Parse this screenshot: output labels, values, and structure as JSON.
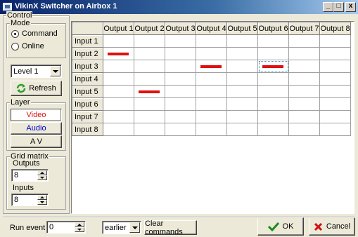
{
  "window": {
    "title": "VikinX Switcher on Airbox 1"
  },
  "title_buttons": {
    "minimize": "_",
    "maximize": "□",
    "close": "x"
  },
  "control": {
    "legend": "Control",
    "mode": {
      "legend": "Mode",
      "options": [
        "Command",
        "Online"
      ],
      "selected": "Command"
    },
    "level": {
      "value": "Level 1"
    },
    "refresh_label": "Refresh",
    "layer": {
      "legend": "Layer",
      "video_label": "Video",
      "audio_label": "Audio",
      "av_label": "A V",
      "video_color": "#e01010",
      "audio_color": "#0000d0"
    },
    "grid_matrix": {
      "legend": "Grid matrix",
      "outputs_label": "Outputs",
      "outputs_value": "8",
      "inputs_label": "Inputs",
      "inputs_value": "8"
    }
  },
  "grid": {
    "columns": [
      "Output 1",
      "Output 2",
      "Output 3",
      "Output 4",
      "Output 5",
      "Output 6",
      "Output 7",
      "Output 8"
    ],
    "rows": [
      "Input 1",
      "Input 2",
      "Input 3",
      "Input 4",
      "Input 5",
      "Input 6",
      "Input 7",
      "Input 8"
    ],
    "routes": [
      {
        "input": "Input 2",
        "output": "Output 1"
      },
      {
        "input": "Input 3",
        "output": "Output 4"
      },
      {
        "input": "Input 3",
        "output": "Output 6"
      },
      {
        "input": "Input 5",
        "output": "Output 2"
      }
    ],
    "focused_cell": {
      "input": "Input 3",
      "output": "Output 6"
    },
    "route_color": "#e01010"
  },
  "bottom": {
    "run_event_label": "Run event",
    "run_event_value": "0",
    "timing_value": "earlier",
    "clear_label": "Clear commands",
    "ok_label": "OK",
    "cancel_label": "Cancel"
  }
}
